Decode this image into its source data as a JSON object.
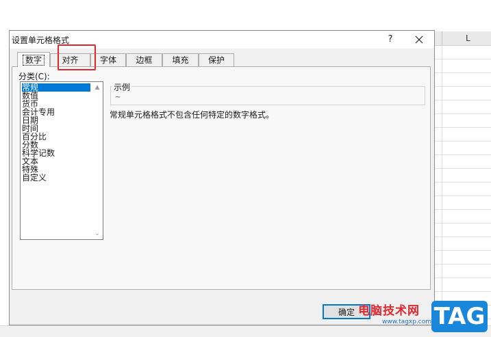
{
  "sheet": {
    "column_letter": "L"
  },
  "dialog": {
    "title": "设置单元格格式",
    "help": "?",
    "tabs": [
      {
        "label": "数字",
        "active": true
      },
      {
        "label": "对齐",
        "active": false
      },
      {
        "label": "字体",
        "active": false
      },
      {
        "label": "边框",
        "active": false
      },
      {
        "label": "填充",
        "active": false
      },
      {
        "label": "保护",
        "active": false
      }
    ],
    "category_label": "分类(C):",
    "categories": [
      "常规",
      "数值",
      "货币",
      "会计专用",
      "日期",
      "时间",
      "百分比",
      "分数",
      "科学记数",
      "文本",
      "特殊",
      "自定义"
    ],
    "selected_category": "常规",
    "sample": {
      "title": "示例",
      "value": "~"
    },
    "description": "常规单元格格式不包含任何特定的数字格式。",
    "ok_label": "确定"
  },
  "watermark": {
    "text": "电脑技术网",
    "url": "www.tagxp.com",
    "tag": "TAG"
  },
  "colors": {
    "accent": "#0078d7",
    "highlight": "#e0272e",
    "tag_bg": "#1a86d9"
  }
}
